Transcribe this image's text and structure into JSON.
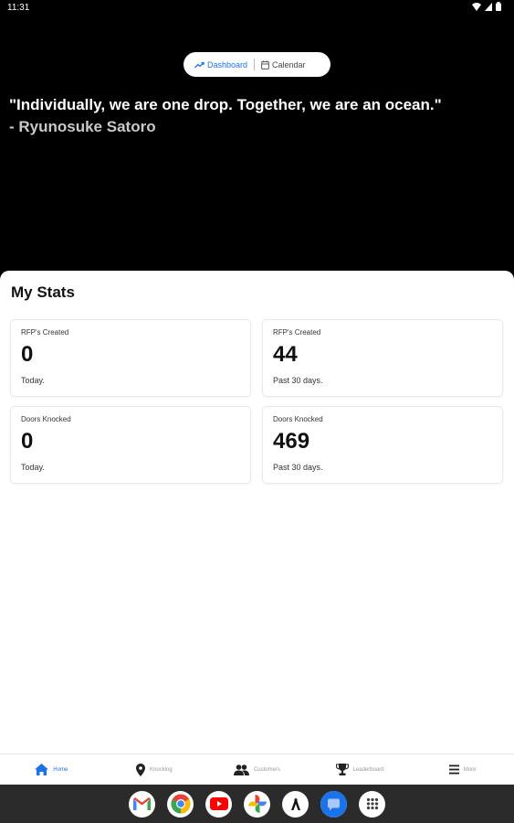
{
  "status": {
    "time": "11:31"
  },
  "toggle": {
    "dashboard": "Dashboard",
    "calendar": "Calendar"
  },
  "quote": {
    "text": "\"Individually, we are one drop. Together, we are an ocean.\"",
    "author": "- Ryunosuke Satoro"
  },
  "stats": {
    "title": "My Stats",
    "cards": [
      {
        "label": "RFP's Created",
        "value": "0",
        "period": "Today."
      },
      {
        "label": "RFP's Created",
        "value": "44",
        "period": "Past 30 days."
      },
      {
        "label": "Doors Knocked",
        "value": "0",
        "period": "Today."
      },
      {
        "label": "Doors Knocked",
        "value": "469",
        "period": "Past 30 days."
      }
    ]
  },
  "nav": {
    "items": [
      {
        "label": "Home",
        "icon": "home-icon",
        "active": true
      },
      {
        "label": "Knocking",
        "icon": "map-pin-icon",
        "active": false
      },
      {
        "label": "Customers",
        "icon": "people-icon",
        "active": false
      },
      {
        "label": "Leaderboard",
        "icon": "trophy-icon",
        "active": false
      },
      {
        "label": "More",
        "icon": "menu-icon",
        "active": false
      }
    ]
  },
  "dock": {
    "apps": [
      "gmail-icon",
      "chrome-icon",
      "youtube-icon",
      "photos-icon",
      "app-icon",
      "messages-icon",
      "app-drawer-icon"
    ]
  },
  "colors": {
    "accent": "#1a73e8",
    "hero_bg": "#000000",
    "card_border": "#e8e8e8"
  }
}
